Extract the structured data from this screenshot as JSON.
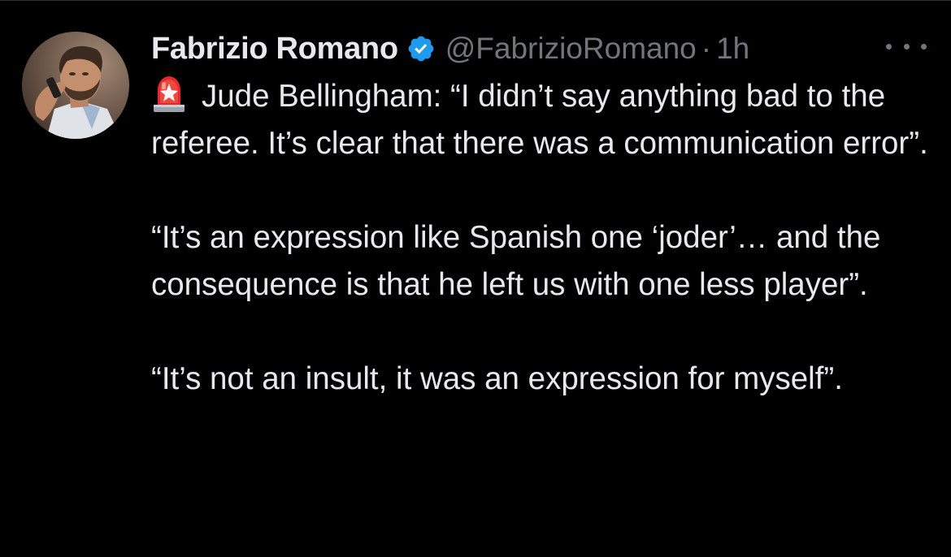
{
  "tweet": {
    "author": {
      "display_name": "Fabrizio Romano",
      "handle": "@FabrizioRomano",
      "verified": true,
      "avatar_icon": "profile-photo",
      "verified_color": "#1d9bf0"
    },
    "separator": "·",
    "timestamp": "1h",
    "more_icon": "ellipsis-icon",
    "emoji_icon": "rotating-light-emoji",
    "paragraphs": [
      "Jude Bellingham: “I didn’t say anything bad to the referee. It’s clear that there was a communication error”.",
      "“It’s an expression like Spanish one ‘joder’… and the consequence is that he left us with one less player”.",
      "“It’s not an insult, it was an expression for myself”."
    ]
  },
  "colors": {
    "background": "#000000",
    "text_primary": "#e7e9ea",
    "text_secondary": "#71767b",
    "accent": "#1d9bf0"
  }
}
